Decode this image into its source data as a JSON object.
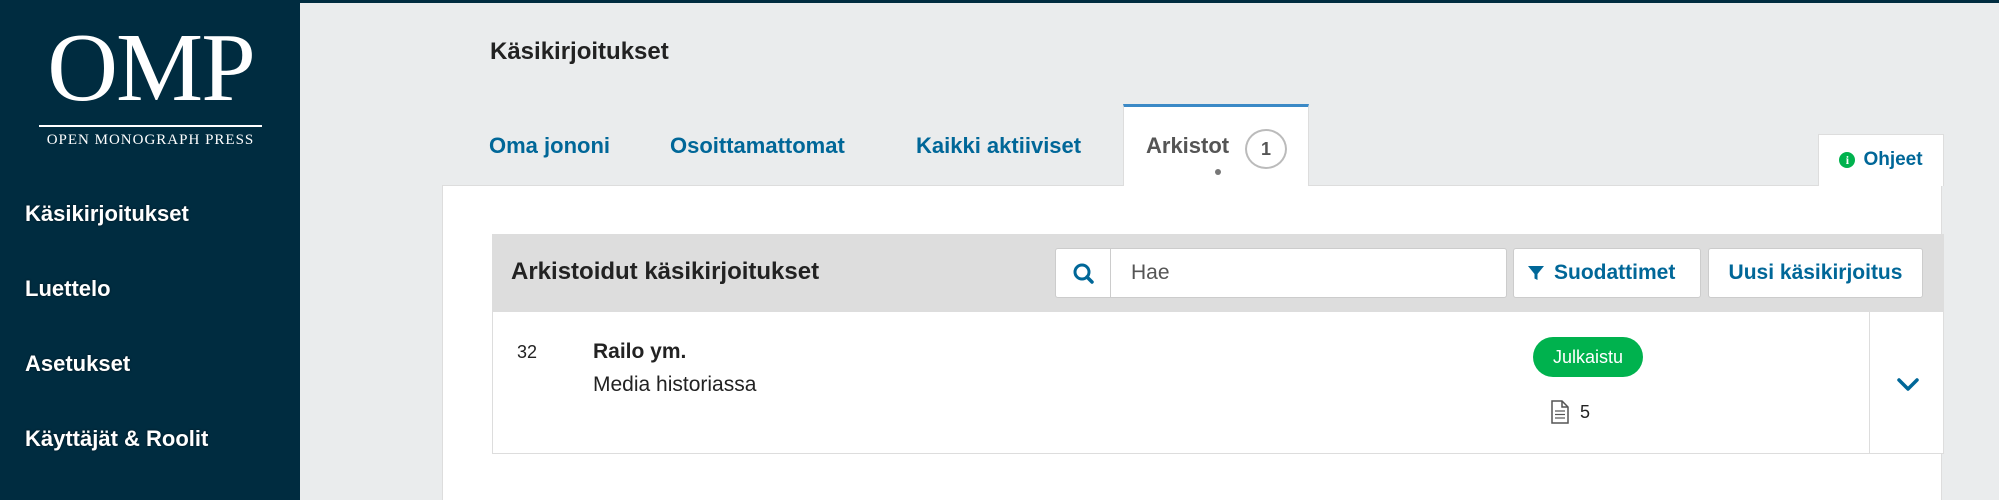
{
  "sidebar": {
    "logo": {
      "wordmark": "OMP",
      "subtitle": "OPEN MONOGRAPH PRESS"
    },
    "items": [
      {
        "label": "Käsikirjoitukset"
      },
      {
        "label": "Luettelo"
      },
      {
        "label": "Asetukset"
      },
      {
        "label": "Käyttäjät & Roolit"
      }
    ]
  },
  "main": {
    "title": "Käsikirjoitukset",
    "tabs": [
      {
        "label": "Oma jononi"
      },
      {
        "label": "Osoittamattomat"
      },
      {
        "label": "Kaikki aktiiviset"
      },
      {
        "label": "Arkistot",
        "count": "1",
        "active": true
      }
    ],
    "help_label": "Ohjeet"
  },
  "list": {
    "title": "Arkistoidut käsikirjoitukset",
    "search": {
      "placeholder": "Hae",
      "value": ""
    },
    "filters_label": "Suodattimet",
    "new_label": "Uusi käsikirjoitus",
    "rows": [
      {
        "id": "32",
        "authors": "Railo ym.",
        "title": "Media historiassa",
        "status": "Julkaistu",
        "files": "5"
      }
    ]
  },
  "icons": {
    "info": "info-icon",
    "search": "search-icon",
    "filter": "filter-icon",
    "file": "file-icon",
    "expand": "chevron-down-icon"
  },
  "colors": {
    "sidebar": "#002c40",
    "link": "#006798",
    "success": "#00b24e",
    "tab_accent": "#3b89c6",
    "page_bg": "#eaeced"
  }
}
